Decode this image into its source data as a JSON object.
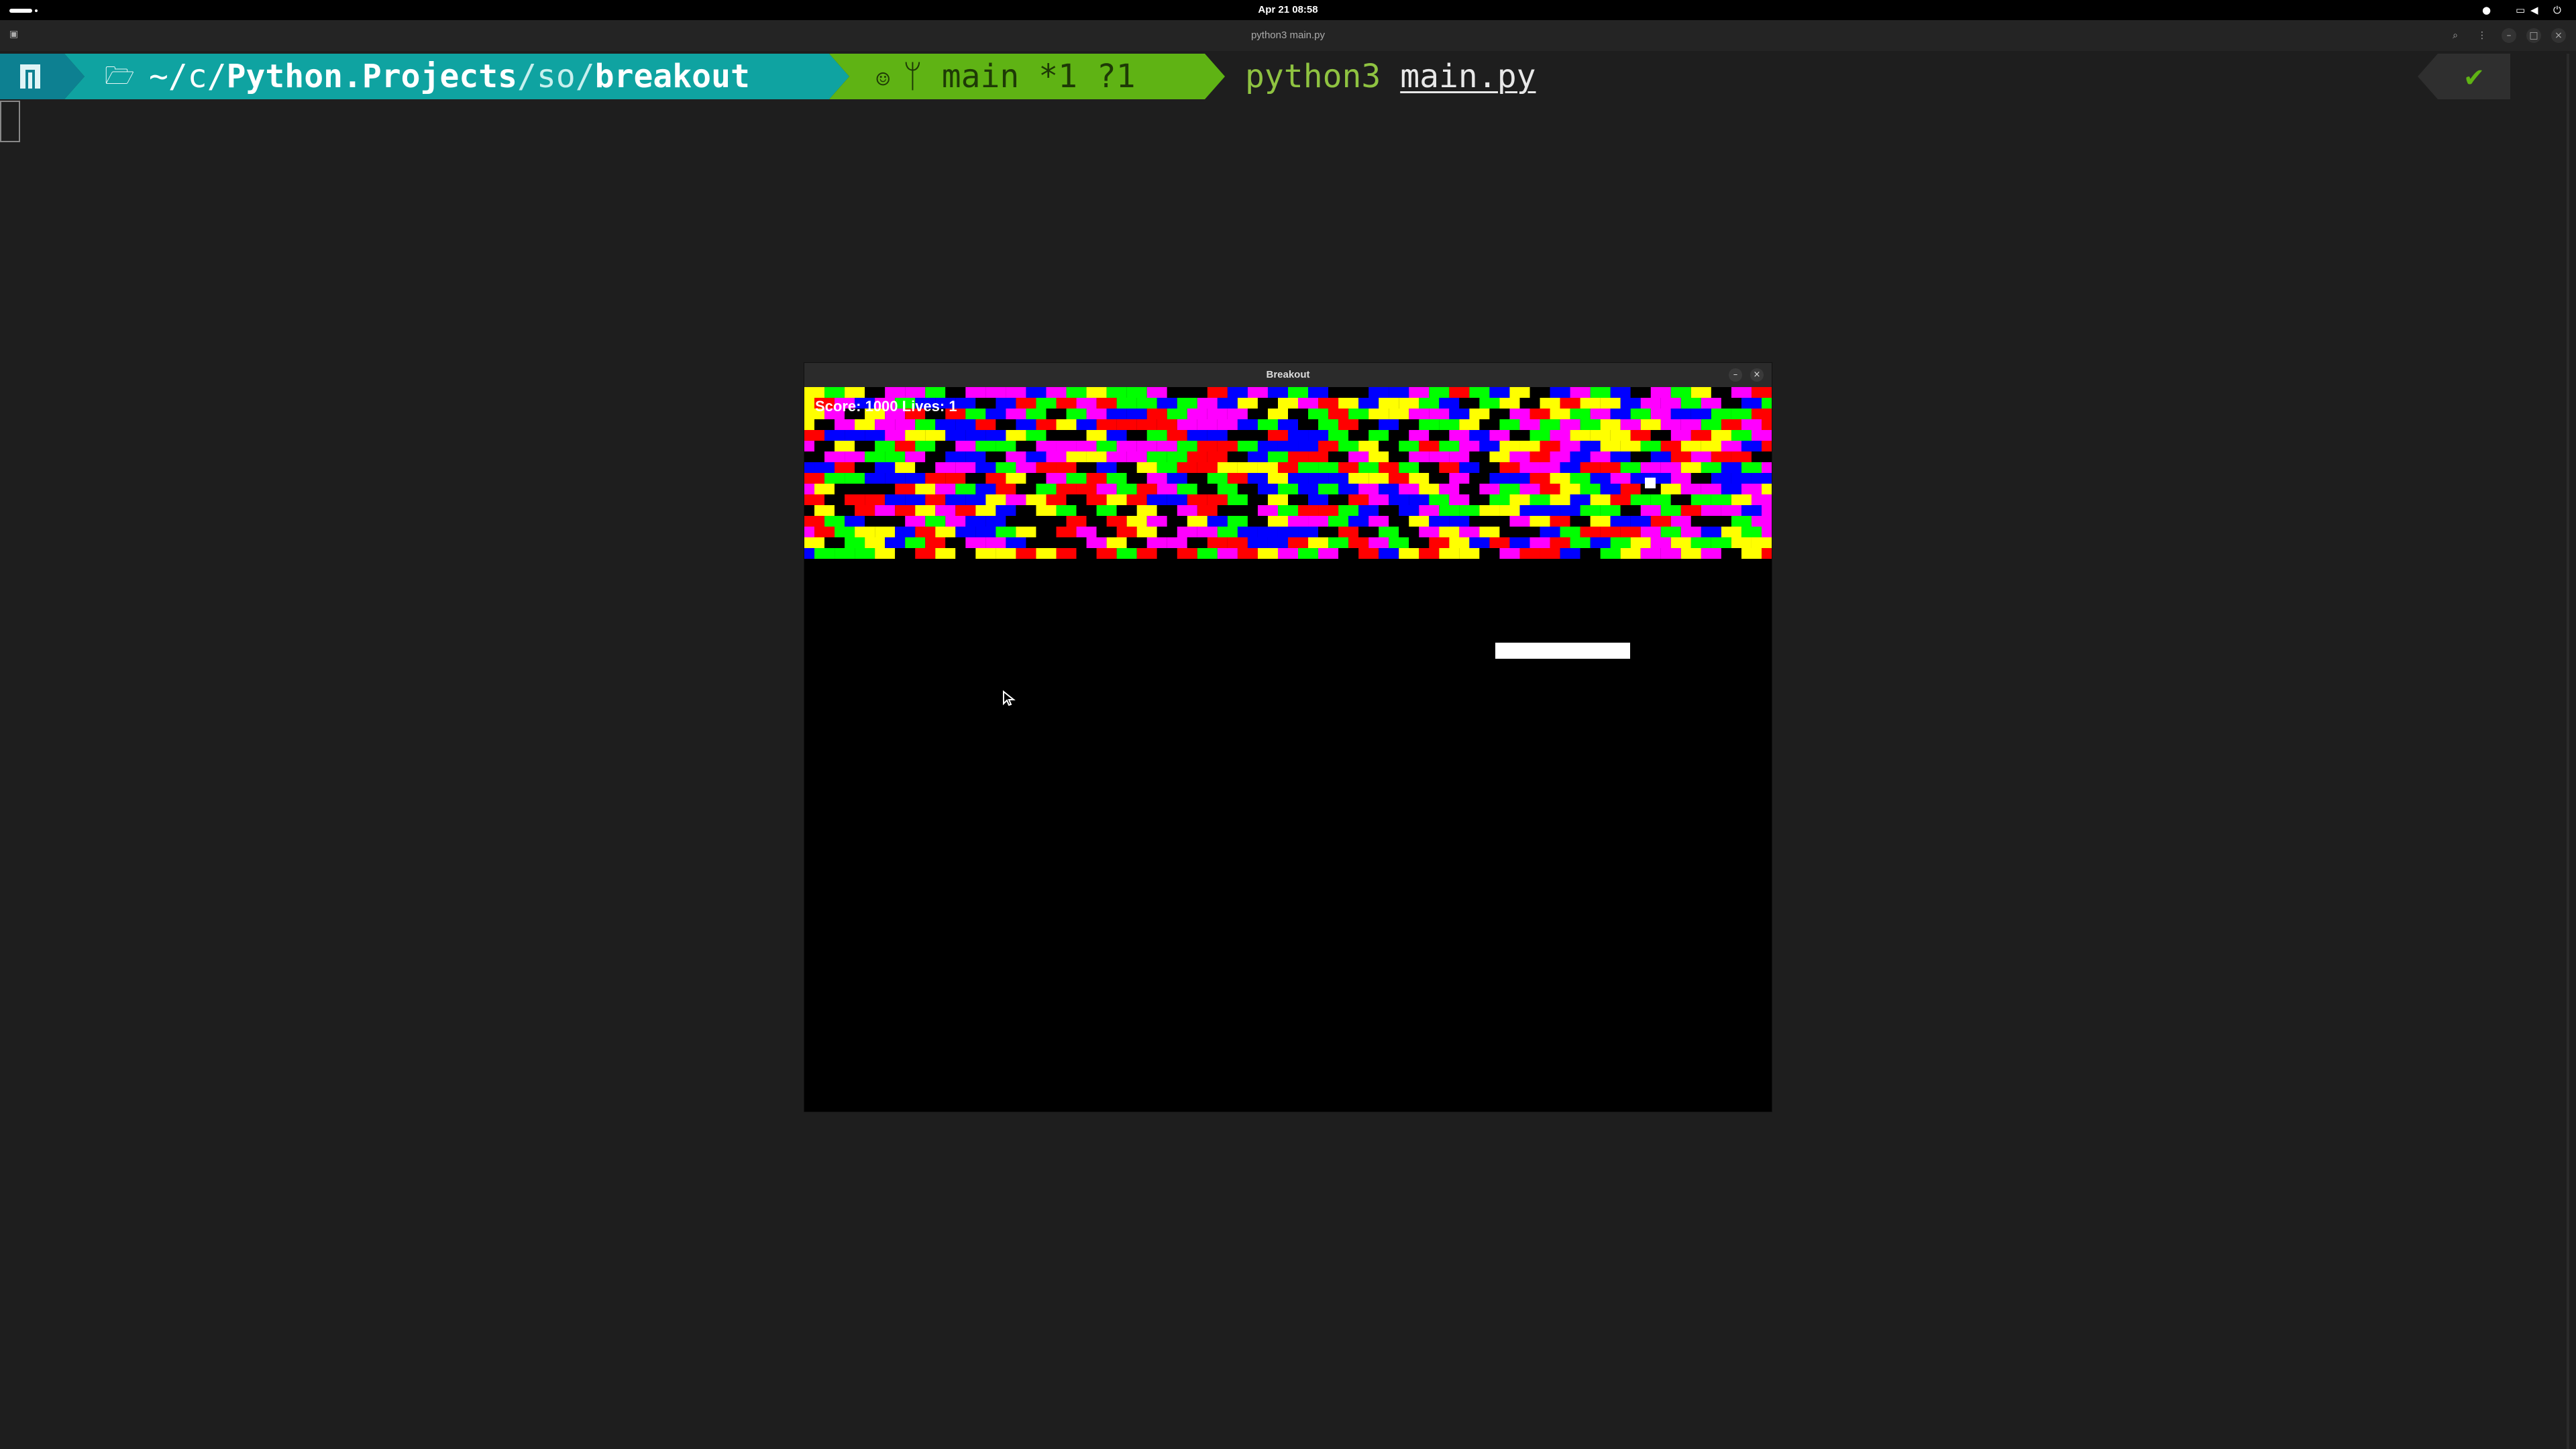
{
  "topbar": {
    "clock": "Apr 21  08:58"
  },
  "terminal": {
    "window_title": "python3 main.py",
    "prompt": {
      "path_prefix": "~/c/",
      "path_mid": "Python.Projects",
      "path_sep": "/so/",
      "path_last": "breakout",
      "git_branch": "main *1 ?1",
      "command": "python3",
      "argument": "main.py",
      "status_symbol": "✔"
    },
    "colors": {
      "os_segment": "#0d8091",
      "path_segment": "#0fa3a1",
      "git_segment": "#5fb314",
      "command": "#8fc341"
    }
  },
  "game": {
    "window_title": "Breakout",
    "hud_text": "Score: 1000 Lives: 1",
    "brick_palette": [
      "#ff0000",
      "#00ff00",
      "#0000ff",
      "#ffff00",
      "#ff00ff",
      "#000000"
    ],
    "brick_rows": 16,
    "brick_cols": 48
  },
  "icons": {
    "activities": "activities-indicator",
    "network": "network-icon",
    "volume": "volume-icon",
    "power": "power-icon",
    "search": "search-icon",
    "menu": "menu-icon"
  }
}
